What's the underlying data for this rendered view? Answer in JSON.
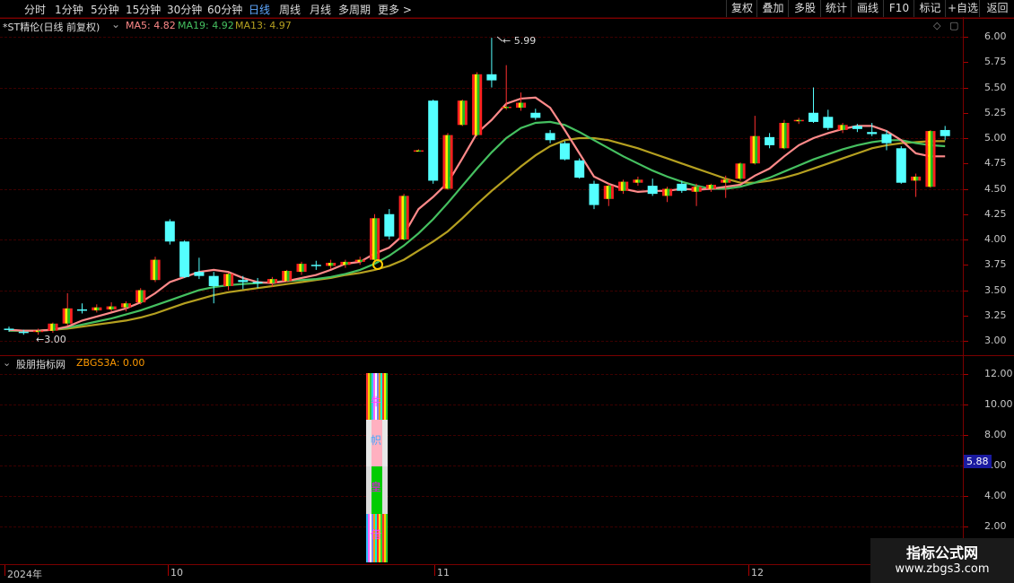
{
  "toolbar": {
    "left": [
      "分时",
      "1分钟",
      "5分钟",
      "15分钟",
      "30分钟",
      "60分钟",
      "日线",
      "周线",
      "月线",
      "多周期",
      "更多 >"
    ],
    "right": [
      "复权",
      "叠加",
      "多股",
      "统计",
      "画线",
      "F10",
      "标记",
      "+自选",
      "返回"
    ]
  },
  "header": {
    "title": "*ST精伦(日线 前复权)",
    "ma5": "MA5: 4.82",
    "ma19": "MA19: 4.92",
    "ma13": "MA13: 4.97"
  },
  "price_axis": [
    "6.00",
    "5.75",
    "5.50",
    "5.25",
    "5.00",
    "4.75",
    "4.50",
    "4.25",
    "4.00",
    "3.75",
    "3.50",
    "3.25",
    "3.00"
  ],
  "annotations": {
    "high": "5.99",
    "low": "3.00"
  },
  "indicator": {
    "title": "股朋指标网",
    "value": "ZBGS3A: 0.00",
    "axis": [
      "12.00",
      "10.00",
      "8.00",
      "6.00",
      "4.00",
      "2.00"
    ],
    "badge": "5.88",
    "bar_chars": [
      "牛",
      "帜",
      "皇",
      "借"
    ]
  },
  "dates": [
    "2024年",
    "10",
    "11",
    "12"
  ],
  "watermark": {
    "line1": "指标公式网",
    "line2": "www.zbgs3.com"
  },
  "colors": {
    "up": "#ff3030",
    "down": "#54ffff",
    "ma5": "#ff8a8a",
    "ma13": "#b5a020",
    "ma19": "#45c060"
  },
  "chart_data": {
    "type": "candlestick",
    "title": "*ST精伦(日线 前复权)",
    "ylim": [
      2.9,
      6.05
    ],
    "candles": [
      {
        "o": 3.12,
        "h": 3.14,
        "l": 3.09,
        "c": 3.11
      },
      {
        "o": 3.09,
        "h": 3.11,
        "l": 3.06,
        "c": 3.08
      },
      {
        "o": 3.09,
        "h": 3.12,
        "l": 3.06,
        "c": 3.1
      },
      {
        "o": 3.1,
        "h": 3.18,
        "l": 3.08,
        "c": 3.17
      },
      {
        "o": 3.17,
        "h": 3.47,
        "l": 3.15,
        "c": 3.32
      },
      {
        "o": 3.31,
        "h": 3.37,
        "l": 3.27,
        "c": 3.3
      },
      {
        "o": 3.3,
        "h": 3.36,
        "l": 3.28,
        "c": 3.33
      },
      {
        "o": 3.31,
        "h": 3.38,
        "l": 3.29,
        "c": 3.34
      },
      {
        "o": 3.33,
        "h": 3.39,
        "l": 3.29,
        "c": 3.37
      },
      {
        "o": 3.38,
        "h": 3.52,
        "l": 3.36,
        "c": 3.5
      },
      {
        "o": 3.6,
        "h": 3.83,
        "l": 3.58,
        "c": 3.8
      },
      {
        "o": 4.18,
        "h": 4.2,
        "l": 3.95,
        "c": 3.98
      },
      {
        "o": 3.98,
        "h": 3.99,
        "l": 3.62,
        "c": 3.63
      },
      {
        "o": 3.68,
        "h": 3.82,
        "l": 3.61,
        "c": 3.64
      },
      {
        "o": 3.64,
        "h": 3.68,
        "l": 3.37,
        "c": 3.54
      },
      {
        "o": 3.54,
        "h": 3.67,
        "l": 3.5,
        "c": 3.66
      },
      {
        "o": 3.6,
        "h": 3.64,
        "l": 3.51,
        "c": 3.58
      },
      {
        "o": 3.58,
        "h": 3.62,
        "l": 3.52,
        "c": 3.57
      },
      {
        "o": 3.57,
        "h": 3.63,
        "l": 3.53,
        "c": 3.61
      },
      {
        "o": 3.59,
        "h": 3.7,
        "l": 3.58,
        "c": 3.69
      },
      {
        "o": 3.68,
        "h": 3.78,
        "l": 3.65,
        "c": 3.76
      },
      {
        "o": 3.75,
        "h": 3.79,
        "l": 3.7,
        "c": 3.74
      },
      {
        "o": 3.74,
        "h": 3.8,
        "l": 3.71,
        "c": 3.77
      },
      {
        "o": 3.75,
        "h": 3.8,
        "l": 3.72,
        "c": 3.78
      },
      {
        "o": 3.78,
        "h": 3.83,
        "l": 3.75,
        "c": 3.8
      },
      {
        "o": 3.8,
        "h": 4.25,
        "l": 3.79,
        "c": 4.21
      },
      {
        "o": 4.25,
        "h": 4.3,
        "l": 4.0,
        "c": 4.03
      },
      {
        "o": 4.0,
        "h": 4.45,
        "l": 3.99,
        "c": 4.43
      },
      {
        "o": 4.88,
        "h": 4.89,
        "l": 4.87,
        "c": 4.88
      },
      {
        "o": 5.37,
        "h": 5.38,
        "l": 4.55,
        "c": 4.58
      },
      {
        "o": 4.5,
        "h": 5.05,
        "l": 4.49,
        "c": 5.03
      },
      {
        "o": 5.13,
        "h": 5.38,
        "l": 5.12,
        "c": 5.37
      },
      {
        "o": 5.03,
        "h": 5.65,
        "l": 5.02,
        "c": 5.63
      },
      {
        "o": 5.63,
        "h": 5.99,
        "l": 5.5,
        "c": 5.57
      },
      {
        "o": 5.3,
        "h": 5.72,
        "l": 5.28,
        "c": 5.31
      },
      {
        "o": 5.3,
        "h": 5.45,
        "l": 5.27,
        "c": 5.35
      },
      {
        "o": 5.25,
        "h": 5.29,
        "l": 5.18,
        "c": 5.2
      },
      {
        "o": 5.05,
        "h": 5.08,
        "l": 4.95,
        "c": 4.98
      },
      {
        "o": 4.95,
        "h": 4.97,
        "l": 4.78,
        "c": 4.79
      },
      {
        "o": 4.78,
        "h": 4.8,
        "l": 4.6,
        "c": 4.61
      },
      {
        "o": 4.55,
        "h": 4.58,
        "l": 4.3,
        "c": 4.34
      },
      {
        "o": 4.4,
        "h": 4.55,
        "l": 4.33,
        "c": 4.53
      },
      {
        "o": 4.48,
        "h": 4.59,
        "l": 4.45,
        "c": 4.57
      },
      {
        "o": 4.56,
        "h": 4.62,
        "l": 4.53,
        "c": 4.59
      },
      {
        "o": 4.53,
        "h": 4.6,
        "l": 4.43,
        "c": 4.45
      },
      {
        "o": 4.43,
        "h": 4.52,
        "l": 4.37,
        "c": 4.5
      },
      {
        "o": 4.55,
        "h": 4.58,
        "l": 4.46,
        "c": 4.48
      },
      {
        "o": 4.47,
        "h": 4.55,
        "l": 4.33,
        "c": 4.52
      },
      {
        "o": 4.5,
        "h": 4.55,
        "l": 4.47,
        "c": 4.54
      },
      {
        "o": 4.56,
        "h": 4.63,
        "l": 4.41,
        "c": 4.59
      },
      {
        "o": 4.6,
        "h": 4.76,
        "l": 4.58,
        "c": 4.75
      },
      {
        "o": 4.75,
        "h": 5.22,
        "l": 4.74,
        "c": 5.02
      },
      {
        "o": 5.01,
        "h": 5.05,
        "l": 4.9,
        "c": 4.93
      },
      {
        "o": 4.9,
        "h": 5.18,
        "l": 4.89,
        "c": 5.15
      },
      {
        "o": 5.18,
        "h": 5.2,
        "l": 5.14,
        "c": 5.18
      },
      {
        "o": 5.25,
        "h": 5.5,
        "l": 5.15,
        "c": 5.16
      },
      {
        "o": 5.21,
        "h": 5.28,
        "l": 5.08,
        "c": 5.1
      },
      {
        "o": 5.08,
        "h": 5.15,
        "l": 5.05,
        "c": 5.13
      },
      {
        "o": 5.12,
        "h": 5.14,
        "l": 5.06,
        "c": 5.09
      },
      {
        "o": 5.06,
        "h": 5.15,
        "l": 5.02,
        "c": 5.04
      },
      {
        "o": 5.04,
        "h": 5.08,
        "l": 4.88,
        "c": 4.95
      },
      {
        "o": 4.9,
        "h": 4.92,
        "l": 4.55,
        "c": 4.56
      },
      {
        "o": 4.58,
        "h": 4.65,
        "l": 4.42,
        "c": 4.62
      },
      {
        "o": 4.52,
        "h": 5.08,
        "l": 4.51,
        "c": 5.07
      },
      {
        "o": 5.08,
        "h": 5.12,
        "l": 4.98,
        "c": 5.02
      }
    ],
    "ma5": [
      3.11,
      3.1,
      3.1,
      3.11,
      3.14,
      3.2,
      3.24,
      3.28,
      3.32,
      3.38,
      3.47,
      3.58,
      3.63,
      3.68,
      3.7,
      3.68,
      3.62,
      3.58,
      3.57,
      3.59,
      3.62,
      3.65,
      3.7,
      3.76,
      3.78,
      3.86,
      3.92,
      4.05,
      4.3,
      4.42,
      4.56,
      4.8,
      5.05,
      5.18,
      5.34,
      5.39,
      5.4,
      5.3,
      5.08,
      4.85,
      4.62,
      4.55,
      4.5,
      4.47,
      4.48,
      4.48,
      4.5,
      4.49,
      4.5,
      4.52,
      4.54,
      4.63,
      4.7,
      4.82,
      4.93,
      5.0,
      5.05,
      5.09,
      5.12,
      5.12,
      5.07,
      4.98,
      4.85,
      4.82,
      4.82
    ],
    "ma13": [
      3.1,
      3.1,
      3.1,
      3.11,
      3.12,
      3.14,
      3.16,
      3.18,
      3.2,
      3.23,
      3.27,
      3.32,
      3.37,
      3.41,
      3.45,
      3.48,
      3.5,
      3.52,
      3.54,
      3.56,
      3.58,
      3.6,
      3.62,
      3.65,
      3.67,
      3.7,
      3.74,
      3.8,
      3.89,
      3.98,
      4.08,
      4.21,
      4.35,
      4.48,
      4.6,
      4.72,
      4.83,
      4.92,
      4.98,
      5.0,
      5.0,
      4.98,
      4.94,
      4.9,
      4.85,
      4.8,
      4.75,
      4.7,
      4.65,
      4.6,
      4.56,
      4.56,
      4.58,
      4.61,
      4.65,
      4.7,
      4.75,
      4.8,
      4.85,
      4.9,
      4.93,
      4.95,
      4.96,
      4.97,
      4.97
    ],
    "ma19": [
      3.1,
      3.1,
      3.1,
      3.11,
      3.13,
      3.16,
      3.19,
      3.22,
      3.26,
      3.3,
      3.35,
      3.4,
      3.45,
      3.5,
      3.53,
      3.55,
      3.56,
      3.57,
      3.58,
      3.59,
      3.6,
      3.61,
      3.63,
      3.66,
      3.7,
      3.76,
      3.84,
      3.94,
      4.06,
      4.2,
      4.36,
      4.53,
      4.7,
      4.86,
      5.0,
      5.1,
      5.15,
      5.16,
      5.13,
      5.06,
      4.98,
      4.9,
      4.82,
      4.75,
      4.68,
      4.62,
      4.57,
      4.53,
      4.5,
      4.5,
      4.52,
      4.56,
      4.61,
      4.67,
      4.73,
      4.79,
      4.84,
      4.89,
      4.93,
      4.96,
      4.98,
      4.98,
      4.95,
      4.93,
      4.92
    ]
  }
}
